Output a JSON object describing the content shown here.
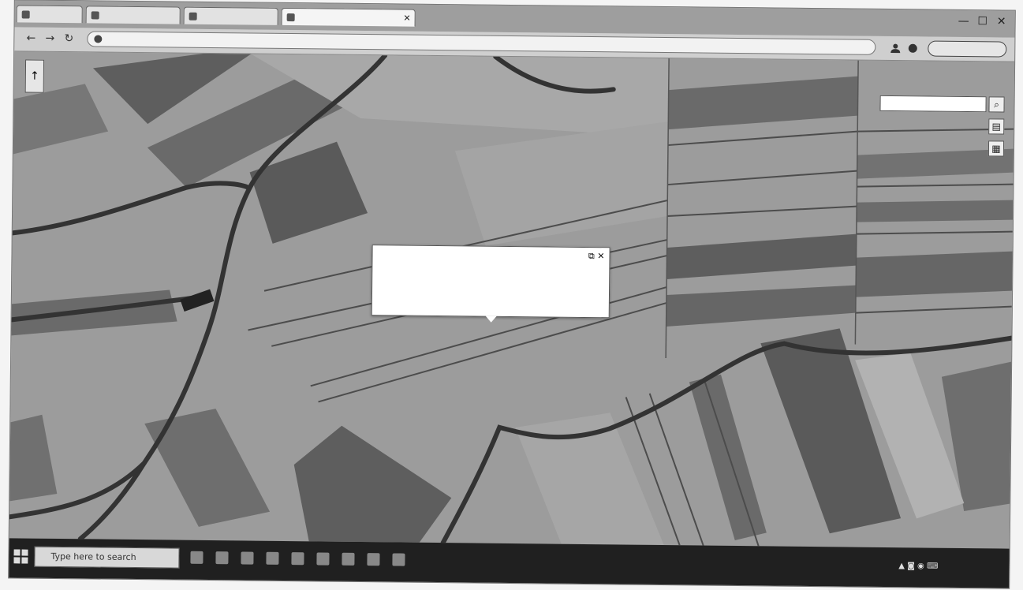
{
  "browser": {
    "tabs": [
      {
        "label": "",
        "active": false
      },
      {
        "label": "",
        "active": false
      },
      {
        "label": "",
        "active": false
      },
      {
        "label": "",
        "active": true
      }
    ],
    "window_controls": {
      "minimize": "—",
      "maximize": "☐",
      "close": "✕"
    },
    "nav": {
      "back": "←",
      "forward": "→",
      "reload": "↻"
    },
    "address": {
      "url": ""
    },
    "profile_button": ""
  },
  "map": {
    "search_placeholder": "",
    "compass": "↑",
    "controls": [
      {
        "name": "search",
        "glyph": "⌕"
      },
      {
        "name": "layers",
        "glyph": "▤"
      },
      {
        "name": "basemap",
        "glyph": "▦"
      }
    ],
    "popup": {
      "title": "",
      "lines": [
        "",
        "",
        ""
      ],
      "link": "",
      "expand": "⧉",
      "close": "✕"
    }
  },
  "taskbar": {
    "search_placeholder": "Type here to search",
    "clock_time": "",
    "clock_date": ""
  },
  "colors": {
    "map_bg": "#9a9a9a",
    "parcel_dark": "#6e6e6e",
    "parcel_light": "#b0b0b0",
    "road": "#3a3a3a",
    "taskbar": "#202020"
  }
}
